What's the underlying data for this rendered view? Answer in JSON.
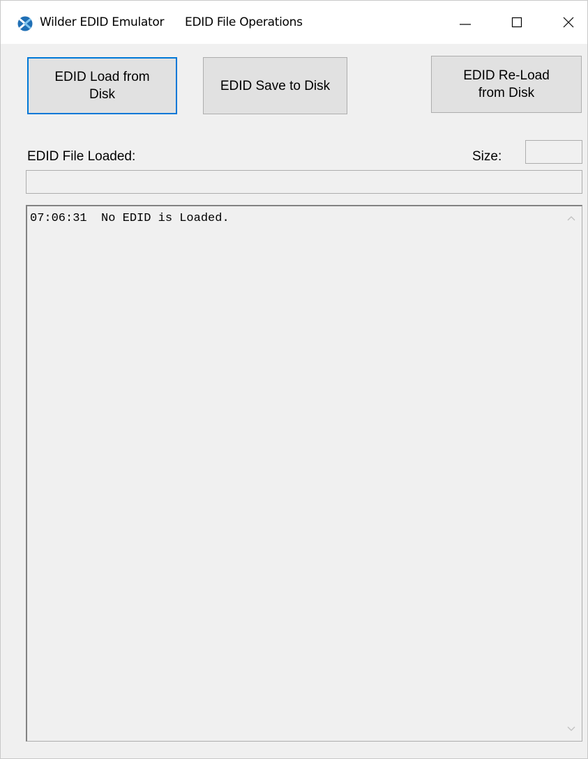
{
  "window": {
    "app_title": "Wilder EDID Emulator",
    "document_title": "EDID File Operations",
    "app_icon": "wilder-logo-icon",
    "accent_color": "#0078d7",
    "caption_buttons": {
      "minimize_icon": "minimize-icon",
      "maximize_icon": "maximize-icon",
      "close_icon": "close-icon"
    }
  },
  "toolbar": {
    "load_label": "EDID Load from Disk",
    "save_label": "EDID Save to Disk",
    "reload_label": "EDID Re-Load from Disk"
  },
  "file_info": {
    "file_loaded_label": "EDID File Loaded:",
    "file_loaded_value": "",
    "size_label": "Size:",
    "size_value": ""
  },
  "log": {
    "lines": "07:06:31  No EDID is Loaded."
  }
}
